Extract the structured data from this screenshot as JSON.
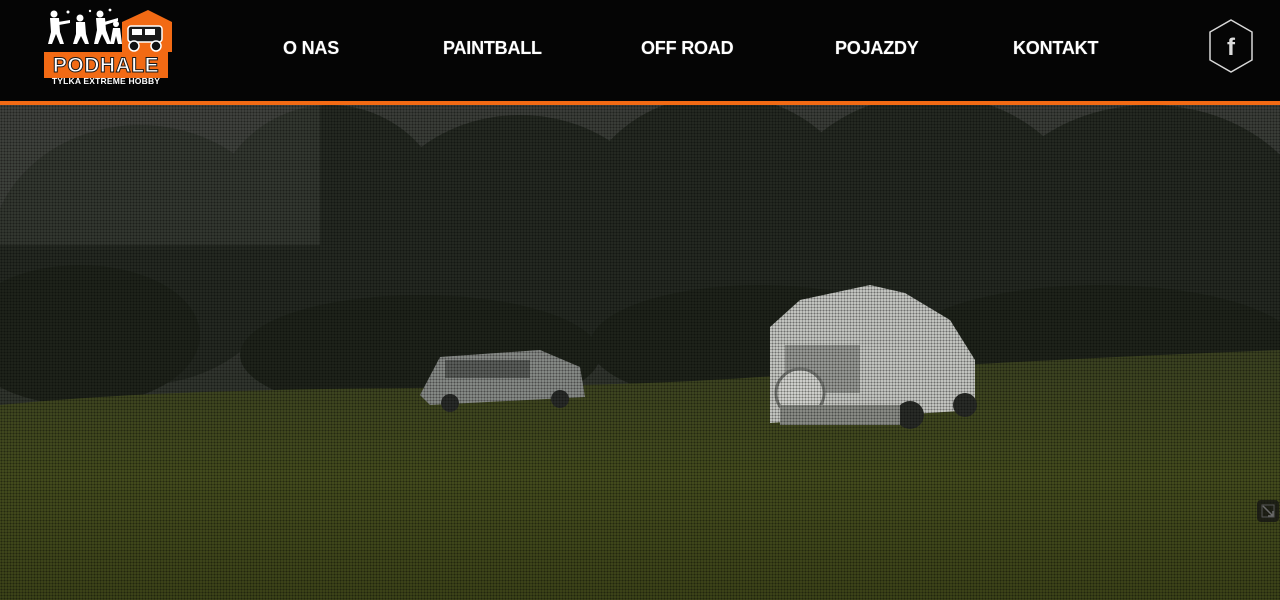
{
  "brand": {
    "name": "PODHALE",
    "tagline": "TYLKA EXTREME HOBBY",
    "accent_color": "#f26a14"
  },
  "nav": {
    "items": [
      {
        "label": "O NAS"
      },
      {
        "label": "PAINTBALL"
      },
      {
        "label": "OFF ROAD"
      },
      {
        "label": "POJAZDY"
      },
      {
        "label": "KONTAKT"
      }
    ]
  },
  "social": {
    "facebook_icon": "facebook-icon",
    "facebook_glyph": "f"
  },
  "hero": {
    "media": "background-video",
    "scene": "off-road vehicles on grass field with trees",
    "control_icon": "expand-icon"
  }
}
